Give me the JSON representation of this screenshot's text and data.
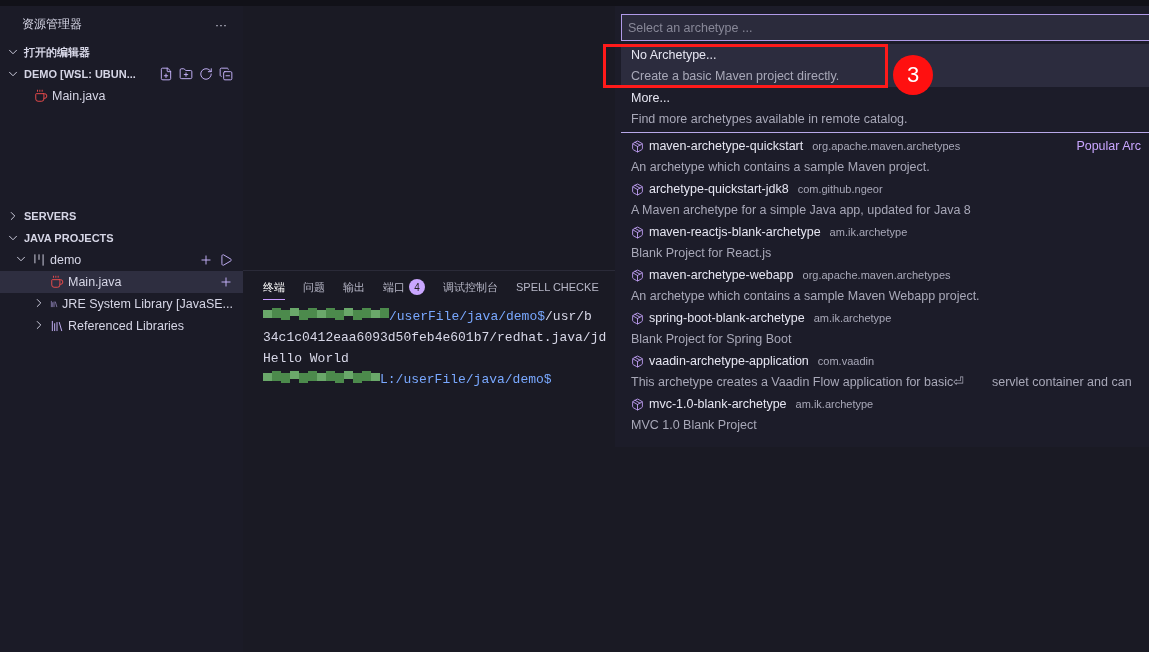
{
  "sidebar": {
    "title": "资源管理器",
    "more": "···",
    "sections": [
      {
        "label": "打开的编辑器",
        "expanded": true,
        "kind": "plain"
      },
      {
        "label": "DEMO [WSL: UBUN...",
        "expanded": true,
        "kind": "folder",
        "items": [
          {
            "label": "Main.java",
            "selected": false
          }
        ]
      },
      {
        "label": "SERVERS",
        "expanded": false,
        "kind": "plain"
      },
      {
        "label": "JAVA PROJECTS",
        "expanded": true,
        "kind": "projects"
      }
    ],
    "tree": [
      {
        "label": "demo",
        "kind": "project",
        "expanded": true,
        "selected": false,
        "children": [
          {
            "label": "Main.java",
            "kind": "file",
            "selected": true
          },
          {
            "label": "JRE System Library [JavaSE...",
            "kind": "library",
            "expanded": false,
            "selected": false
          },
          {
            "label": "Referenced Libraries",
            "kind": "library",
            "expanded": false,
            "selected": false
          }
        ]
      }
    ]
  },
  "panel": {
    "tabs": [
      {
        "label": "终端",
        "selected": true
      },
      {
        "label": "问题",
        "selected": false
      },
      {
        "label": "输出",
        "selected": false
      },
      {
        "label": "端口",
        "selected": false,
        "badge": "4"
      },
      {
        "label": "调试控制台",
        "selected": false
      },
      {
        "label": "SPELL CHECKE",
        "selected": false
      }
    ],
    "terminal": [
      {
        "kind": "prompt",
        "path": "/userFile/java/demo$",
        "rest": "  /usr/b"
      },
      {
        "kind": "text",
        "text": "34c1c0412eaa6093d50feb4e601b7/redhat.java/jd"
      },
      {
        "kind": "text",
        "text": "Hello World"
      },
      {
        "kind": "prompt",
        "path": "L:/userFile/java/demo$"
      }
    ]
  },
  "quick_pick": {
    "placeholder": "Select an archetype ...",
    "annotation": "3",
    "items": [
      {
        "kind": "plain",
        "label": "No Archetype...",
        "description": "Create a basic Maven project directly.",
        "selected": true
      },
      {
        "kind": "plain",
        "label": "More...",
        "description": "Find more archetypes available in remote catalog.",
        "selected": false
      },
      {
        "kind": "archetype",
        "label": "maven-archetype-quickstart",
        "group": "org.apache.maven.archetypes",
        "category": "Popular Arc",
        "description": "An archetype which contains a sample Maven project.",
        "selected": false
      },
      {
        "kind": "archetype",
        "label": "archetype-quickstart-jdk8",
        "group": "com.github.ngeor",
        "description": "A Maven archetype for a simple Java app, updated for Java 8",
        "selected": false
      },
      {
        "kind": "archetype",
        "label": "maven-reactjs-blank-archetype",
        "group": "am.ik.archetype",
        "description": "Blank Project for React.js",
        "selected": false
      },
      {
        "kind": "archetype",
        "label": "maven-archetype-webapp",
        "group": "org.apache.maven.archetypes",
        "description": "An archetype which contains a sample Maven Webapp project.",
        "selected": false
      },
      {
        "kind": "archetype",
        "label": "spring-boot-blank-archetype",
        "group": "am.ik.archetype",
        "description": "Blank Project for Spring Boot",
        "selected": false
      },
      {
        "kind": "archetype",
        "label": "vaadin-archetype-application",
        "group": "com.vaadin",
        "description": "This archetype creates a Vaadin Flow application for basic⏎        servlet container and can",
        "selected": false
      },
      {
        "kind": "archetype",
        "label": "mvc-1.0-blank-archetype",
        "group": "am.ik.archetype",
        "description": "MVC 1.0 Blank Project",
        "selected": false
      }
    ]
  }
}
